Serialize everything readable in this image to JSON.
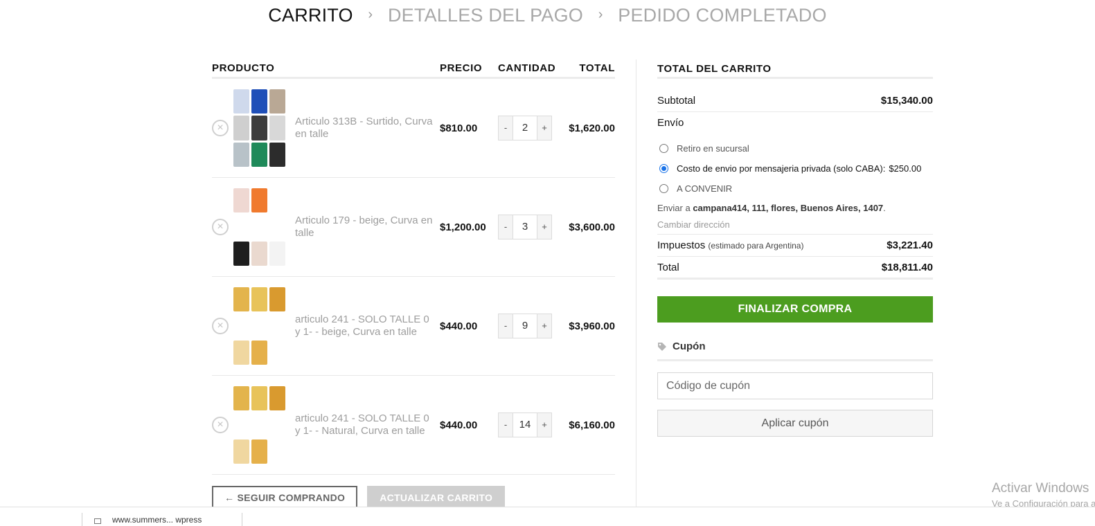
{
  "steps": {
    "cart": "CARRITO",
    "payment": "DETALLES DEL PAGO",
    "completed": "PEDIDO COMPLETADO",
    "separator": "›"
  },
  "table": {
    "headers": {
      "product": "PRODUCTO",
      "price": "PRECIO",
      "quantity": "CANTIDAD",
      "total": "TOTAL"
    },
    "remove_icon": "×",
    "minus": "-",
    "plus": "+",
    "rows": [
      {
        "name": "Articulo 313B - Surtido, Curva en talle",
        "price": "$810.00",
        "qty": "2",
        "total": "$1,620.00",
        "thumb_colors": [
          "#cfd9ec",
          "#1f4fb8",
          "#b9a895",
          "#cfcfcf",
          "#3d3d3d",
          "#d8d8d8",
          "#b8c2c8",
          "#1f8a5a",
          "#2c2c2c"
        ]
      },
      {
        "name": "Articulo 179 - beige, Curva en talle",
        "price": "$1,200.00",
        "qty": "3",
        "total": "$3,600.00",
        "thumb_colors": [
          "#efd8d2",
          "#f07a2e",
          "#ffffff",
          "#ffffff",
          "#ffffff",
          "#ffffff",
          "#1e1e1e",
          "#ead9cf",
          "#f3f3f3"
        ]
      },
      {
        "name": "articulo 241 - SOLO TALLE 0 y 1- - beige, Curva en talle",
        "price": "$440.00",
        "qty": "9",
        "total": "$3,960.00",
        "thumb_colors": [
          "#e3b44c",
          "#e8c35a",
          "#d99a2f",
          "#ffffff",
          "#ffffff",
          "#ffffff",
          "#f0d7a0",
          "#e5b04a",
          "#ffffff"
        ]
      },
      {
        "name": "articulo 241 - SOLO TALLE 0 y 1- - Natural, Curva en talle",
        "price": "$440.00",
        "qty": "14",
        "total": "$6,160.00",
        "thumb_colors": [
          "#e3b44c",
          "#e8c35a",
          "#d99a2f",
          "#ffffff",
          "#ffffff",
          "#ffffff",
          "#f0d7a0",
          "#e5b04a",
          "#ffffff"
        ]
      }
    ]
  },
  "actions": {
    "continue_label": "← SEGUIR COMPRANDO",
    "update_label": "ACTUALIZAR CARRITO"
  },
  "totals": {
    "title": "TOTAL DEL CARRITO",
    "subtotal_label": "Subtotal",
    "subtotal_value": "$15,340.00",
    "shipping_label": "Envío",
    "shipping_options": [
      {
        "label": "Retiro en sucursal",
        "amount": "",
        "selected": false
      },
      {
        "label": "Costo de envio por mensajeria privada (solo CABA):",
        "amount": "$250.00",
        "selected": true
      },
      {
        "label": "A CONVENIR",
        "amount": "",
        "selected": false
      }
    ],
    "ship_to_prefix": "Enviar a ",
    "ship_to_address": "campana414, 111, flores, Buenos Aires, 1407",
    "ship_to_suffix": ".",
    "change_address": "Cambiar dirección",
    "taxes_label": "Impuestos",
    "taxes_note": "(estimado para Argentina)",
    "taxes_value": "$3,221.40",
    "total_label": "Total",
    "total_value": "$18,811.40",
    "checkout_label": "FINALIZAR COMPRA"
  },
  "coupon": {
    "title": "Cupón",
    "placeholder": "Código de cupón",
    "apply_label": "Aplicar cupón"
  },
  "watermark": {
    "line1": "Activar Windows",
    "line2": "Ve a Configuración para activar Windows."
  },
  "taskbar": {
    "item_text": "www.summers... wpress"
  },
  "colors": {
    "accent_green": "#4c9d1f",
    "radio_selected": "#1a73e8"
  }
}
